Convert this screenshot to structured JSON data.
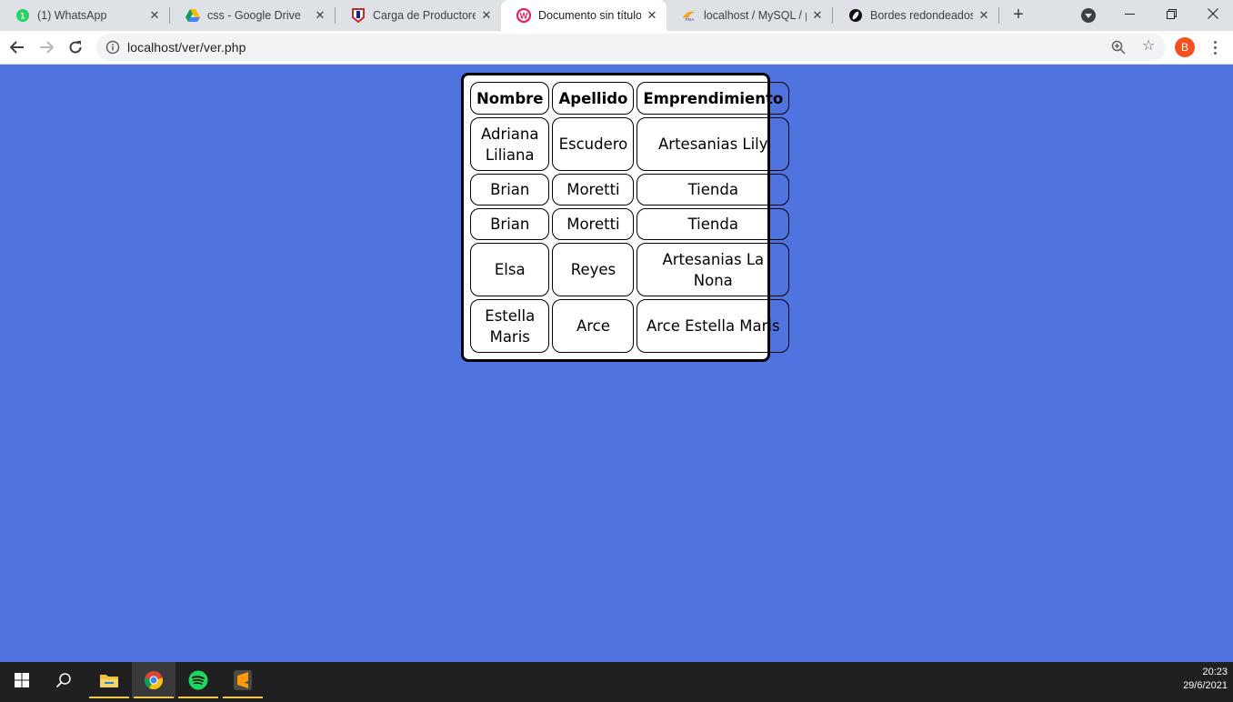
{
  "browser": {
    "tabs": [
      {
        "title": "(1) WhatsApp",
        "icon": "whatsapp-icon",
        "active": false
      },
      {
        "title": "css - Google Drive",
        "icon": "google-drive-icon",
        "active": false
      },
      {
        "title": "Carga de Productores",
        "icon": "site-icon",
        "active": false
      },
      {
        "title": "Documento sin título",
        "icon": "wamp-icon",
        "active": true
      },
      {
        "title": "localhost / MySQL / pr",
        "icon": "phpmyadmin-icon",
        "active": false
      },
      {
        "title": "Bordes redondeados e",
        "icon": "site-icon",
        "active": false
      }
    ],
    "url": "localhost/ver/ver.php",
    "profile_initial": "B"
  },
  "table": {
    "headers": [
      "Nombre",
      "Apellido",
      "Emprendimiento"
    ],
    "rows": [
      [
        "Adriana Liliana",
        "Escudero",
        "Artesanias Lily"
      ],
      [
        "Brian",
        "Moretti",
        "Tienda"
      ],
      [
        "Brian",
        "Moretti",
        "Tienda"
      ],
      [
        "Elsa",
        "Reyes",
        "Artesanias La Nona"
      ],
      [
        "Estella Maris",
        "Arce",
        "Arce Estella Maris"
      ]
    ]
  },
  "taskbar": {
    "time": "20:23",
    "date": "29/6/2021"
  },
  "colors": {
    "page_background": "#4f74e0",
    "tab_strip": "#dee1e6",
    "taskbar": "#202020"
  }
}
